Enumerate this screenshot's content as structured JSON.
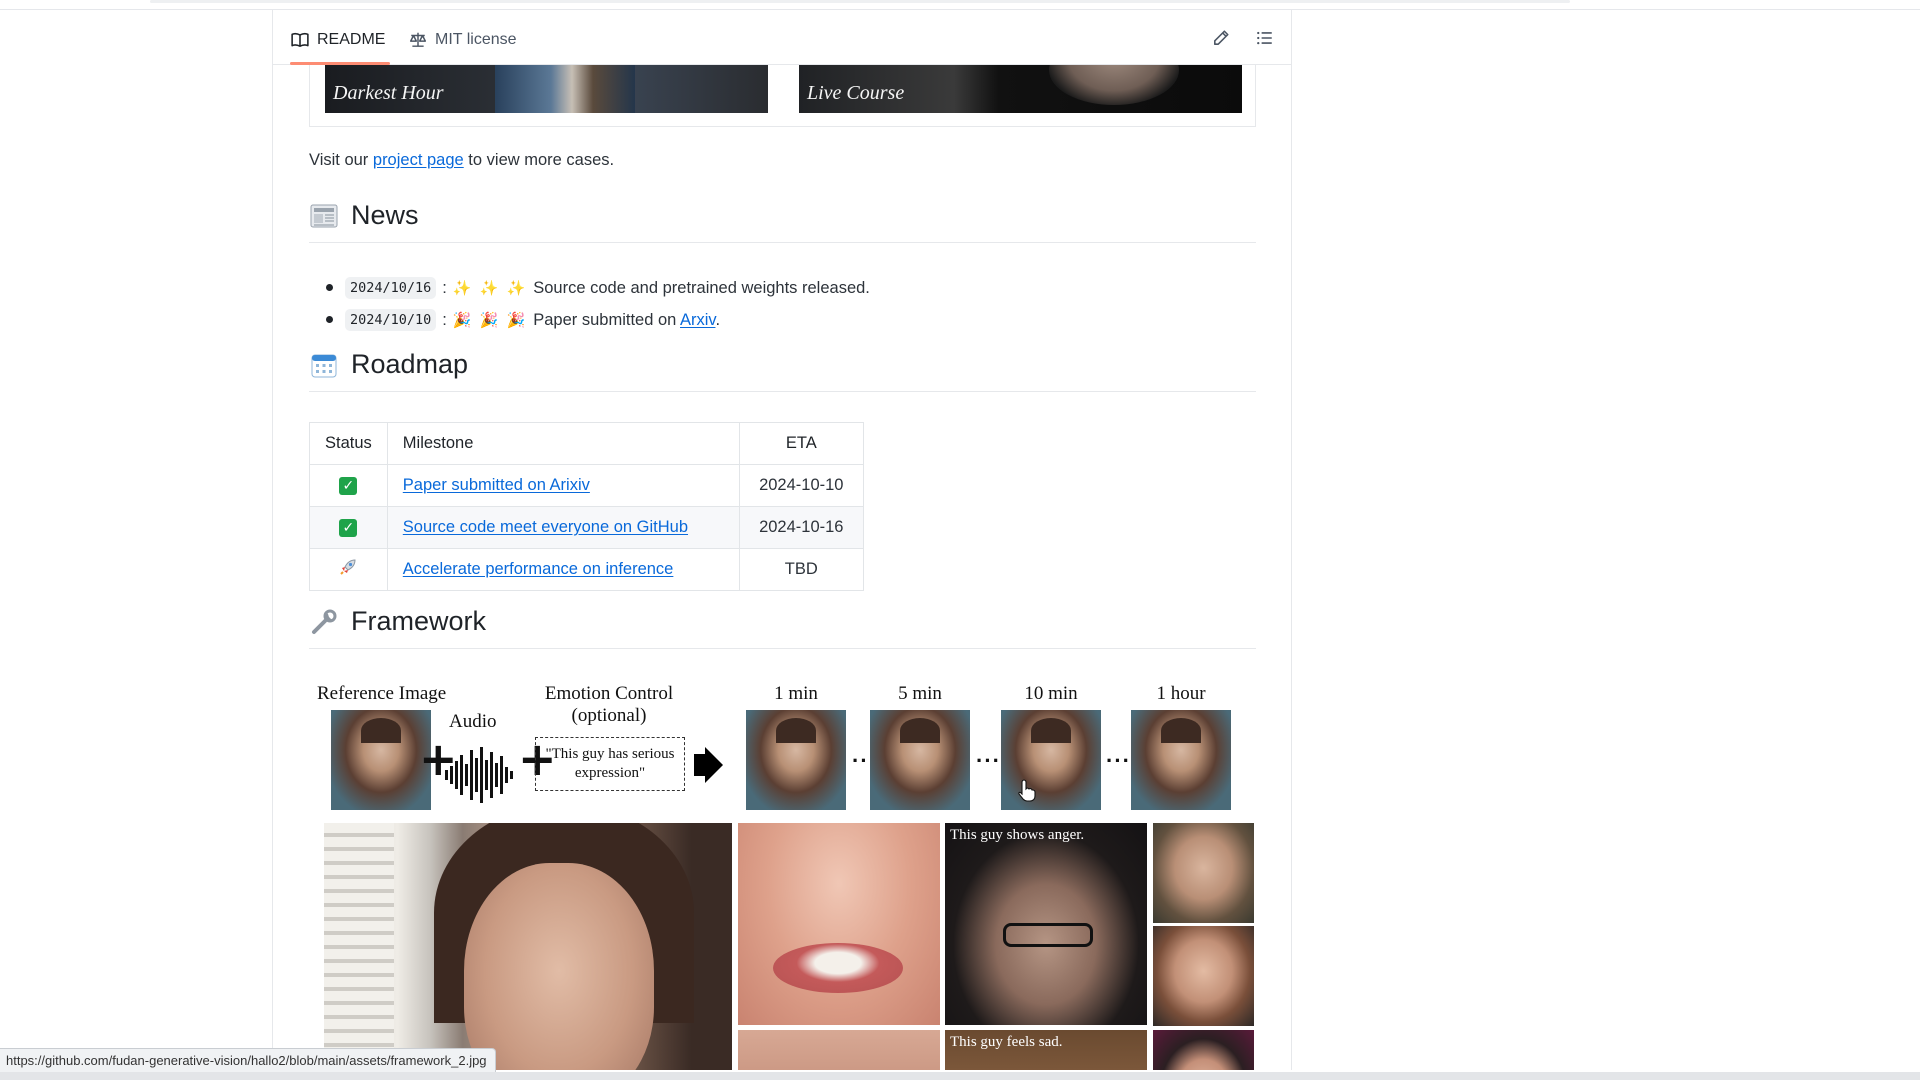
{
  "tabs": {
    "readme": "README",
    "license": "MIT license"
  },
  "gallery": {
    "left_caption": "Darkest Hour",
    "right_caption": "Live Course"
  },
  "visit": {
    "before": "Visit our ",
    "link": "project page",
    "after": " to view more cases."
  },
  "news": {
    "title": "News",
    "items": [
      {
        "date": "2024/10/16",
        "sep": ":",
        "emoji": "✨ ✨ ✨",
        "text": "Source code and pretrained weights released.",
        "link": "",
        "after": ""
      },
      {
        "date": "2024/10/10",
        "sep": ":",
        "emoji": "🎉 🎉 🎉",
        "text": "Paper submitted on ",
        "link": "Arxiv",
        "after": "."
      }
    ]
  },
  "roadmap": {
    "title": "Roadmap",
    "headers": {
      "status": "Status",
      "milestone": "Milestone",
      "eta": "ETA"
    },
    "rows": [
      {
        "status": "done",
        "milestone": "Paper submitted on Arixiv",
        "eta": "2024-10-10"
      },
      {
        "status": "done",
        "milestone": "Source code meet everyone on GitHub",
        "eta": "2024-10-16"
      },
      {
        "status": "rocket",
        "milestone": "Accelerate performance on inference",
        "eta": "TBD"
      }
    ]
  },
  "framework": {
    "title": "Framework",
    "reference": "Reference Image",
    "audio": "Audio",
    "emotion_line1": "Emotion Control",
    "emotion_line2": "(optional)",
    "emotion_text": "\"This guy has serious expression\"",
    "times": [
      "1 min",
      "5 min",
      "10 min",
      "1 hour"
    ],
    "caption_anger": "This guy shows anger.",
    "caption_sad": "This guy feels sad."
  },
  "status_url": "https://github.com/fudan-generative-vision/hallo2/blob/main/assets/framework_2.jpg",
  "colors": {
    "link": "#0969da",
    "tab_underline": "#fd8c73",
    "check": "#1fa34a"
  }
}
